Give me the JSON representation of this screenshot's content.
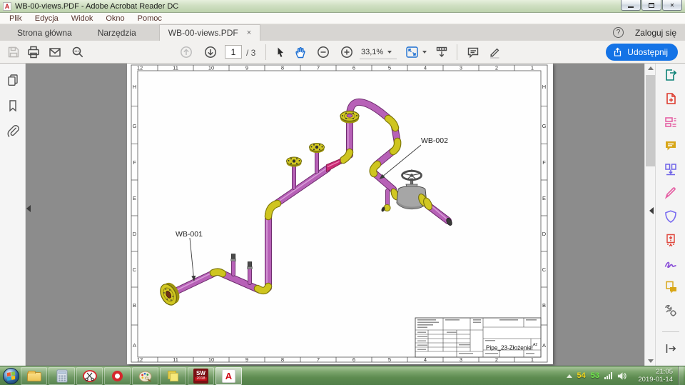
{
  "window": {
    "title": "WB-00-views.PDF - Adobe Acrobat Reader DC"
  },
  "menu": {
    "items": [
      "Plik",
      "Edycja",
      "Widok",
      "Okno",
      "Pomoc"
    ]
  },
  "tabs": {
    "home": "Strona główna",
    "tools": "Narzędzia",
    "document": "WB-00-views.PDF",
    "close_glyph": "×",
    "help_glyph": "?",
    "sign_in": "Zaloguj się"
  },
  "toolbar": {
    "page_current": "1",
    "page_total": "/ 3",
    "zoom_value": "33,1%",
    "share_label": "Udostępnij"
  },
  "document": {
    "grid_columns": [
      "12",
      "11",
      "10",
      "9",
      "8",
      "7",
      "6",
      "5",
      "4",
      "3",
      "2",
      "1"
    ],
    "grid_rows": [
      "H",
      "G",
      "F",
      "E",
      "D",
      "C",
      "B",
      "A"
    ],
    "labels": {
      "wb001": "WB-001",
      "wb002": "WB-002"
    },
    "title_block": {
      "part_name": "Pipe_23-Złożenie!",
      "sheet_format": "A2"
    }
  },
  "taskbar": {
    "solidworks_line1": "SW",
    "solidworks_line2": "2018",
    "acrobat_glyph": "A",
    "tray": {
      "value_yellow": "54",
      "value_green": "53",
      "time": "21:05",
      "date": "2019-01-14"
    }
  },
  "colors": {
    "accent_blue": "#1473e6",
    "pipe_magenta": "#b761b7",
    "fitting_yellow": "#d1c721",
    "reducer_pink": "#c92a74",
    "valve_grey": "#a6a6a6",
    "taskbar_green": "#6a9b58",
    "tray_yellow": "#f0d51d",
    "tray_green": "#6ee84a"
  }
}
